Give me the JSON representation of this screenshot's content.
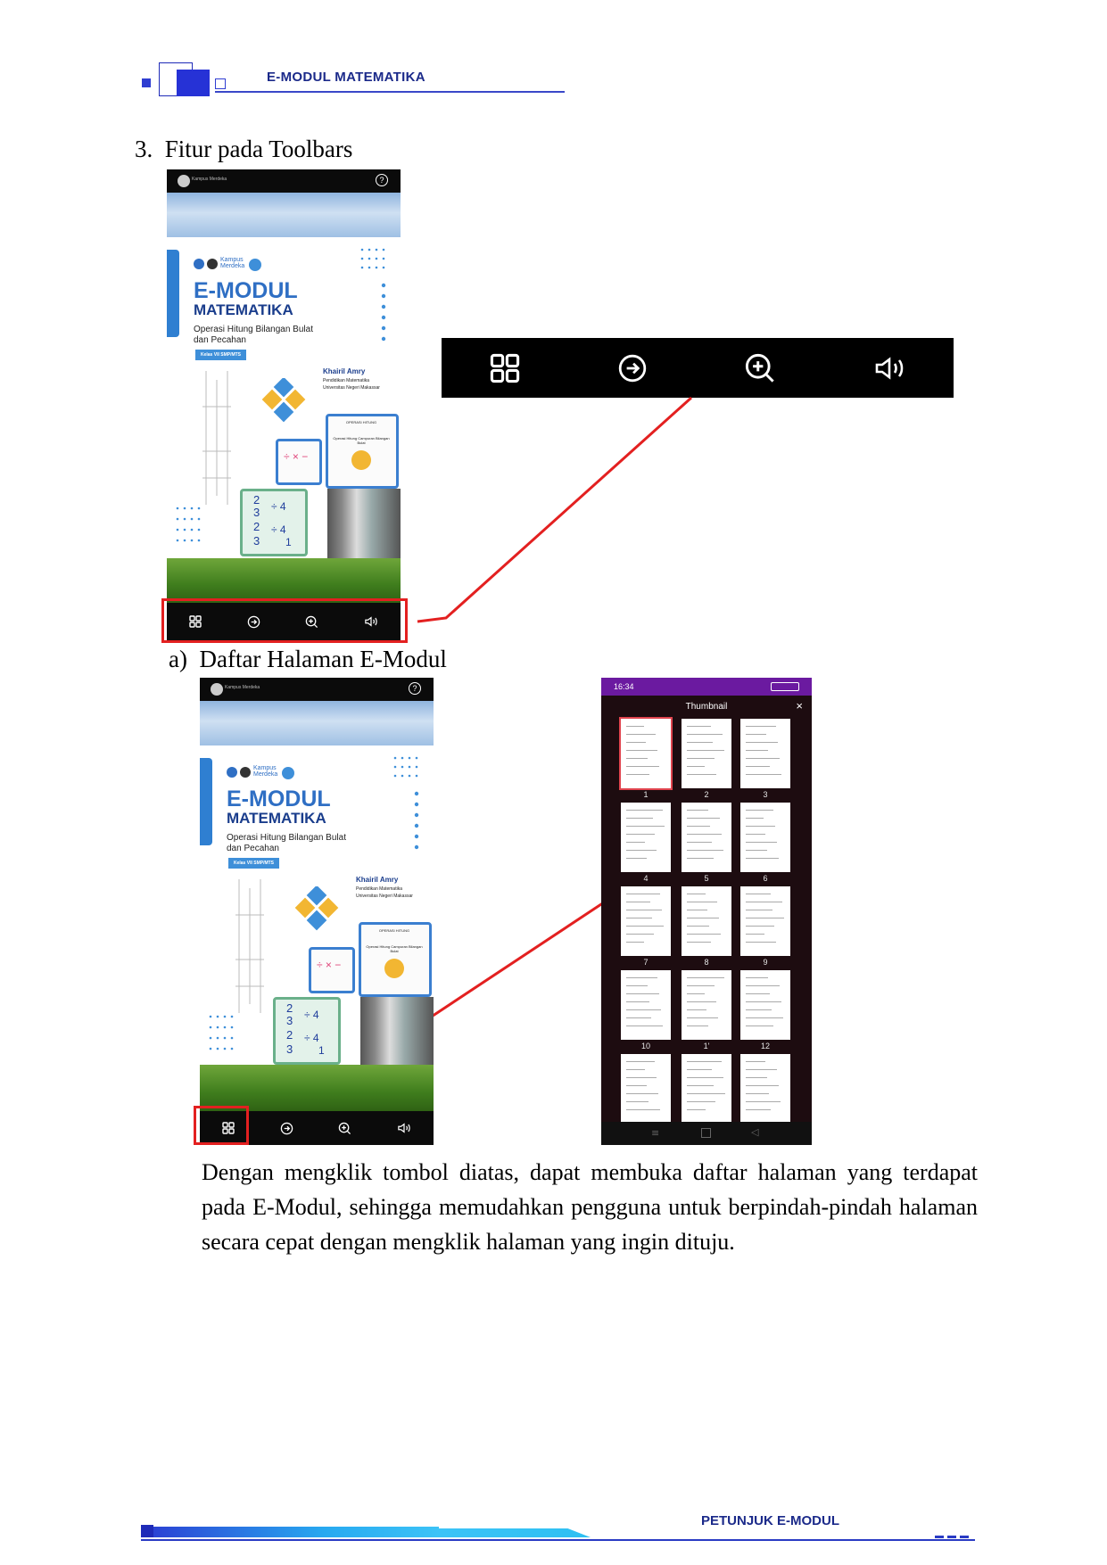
{
  "header": {
    "title": "E-MODUL MATEMATIKA"
  },
  "section": {
    "heading": "3.  Fitur pada Toolbars"
  },
  "subsection": {
    "heading": "a)  Daftar Halaman E-Modul"
  },
  "cover": {
    "logo_text": "Kampus Merdeka",
    "title_line1": "E-MODUL",
    "title_line2": "MATEMATIKA",
    "subtitle_line1": "Operasi Hitung Bilangan Bulat",
    "subtitle_line2": "dan Pecahan",
    "class_badge": "Kelas VII SMP/MTS",
    "author": "Khairil Amry",
    "author_dept": "Pendidikan Matematika",
    "author_univ": "Universitas Negeri Makassar",
    "card_text1": "OPERASI HITUNG",
    "card_text2": "Operasi Hitung Campuran Bilangan Bulat",
    "fraction_lines": [
      "2",
      "3",
      "2",
      "3"
    ],
    "fraction_ops": [
      "÷ 4",
      "÷ 4",
      "1"
    ]
  },
  "toolbar": {
    "icons": [
      "grid-icon",
      "forward-icon",
      "zoom-in-icon",
      "speaker-icon"
    ]
  },
  "thumbnail_screen": {
    "status_time": "16:34",
    "title": "Thumbnail",
    "close": "×",
    "page_numbers": [
      "1",
      "2",
      "3",
      "4",
      "5",
      "6",
      "7",
      "8",
      "9",
      "10",
      "1'",
      "12"
    ]
  },
  "paragraph": "Dengan mengklik tombol diatas, dapat membuka daftar halaman yang terdapat pada E-Modul, sehingga memudahkan pengguna untuk berpindah-pindah halaman secara cepat dengan mengklik halaman yang ingin dituju.",
  "footer": {
    "title": "PETUNJUK E-MODUL"
  },
  "colors": {
    "accent": "#1b2a8a",
    "highlight": "#e32020",
    "brand_blue": "#2f6fc4"
  }
}
